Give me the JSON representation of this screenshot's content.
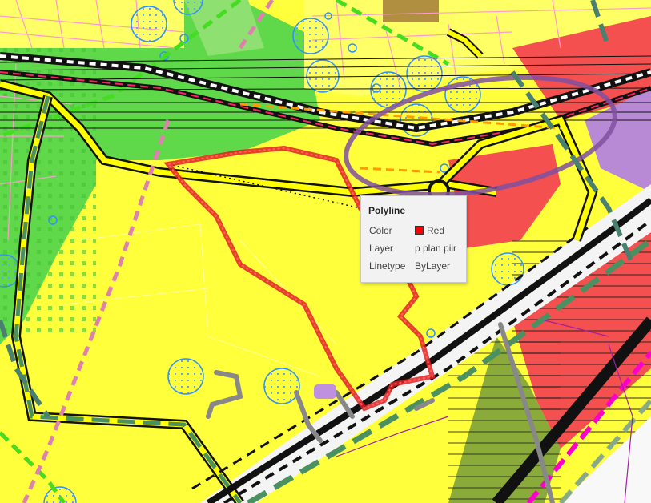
{
  "tooltip": {
    "title": "Polyline",
    "rows": [
      {
        "label": "Color",
        "value": "Red",
        "swatch": "#ff0000"
      },
      {
        "label": "Layer",
        "value": "p plan piir"
      },
      {
        "label": "Linetype",
        "value": "ByLayer"
      }
    ]
  },
  "colors": {
    "residential_yellow": "#ffff3c",
    "green_area": "#5fd84a",
    "olive_area": "#8aaa3a",
    "red_commercial": "#f55050",
    "purple_zone": "#b88ad6",
    "selected_polyline": "#e02020"
  }
}
